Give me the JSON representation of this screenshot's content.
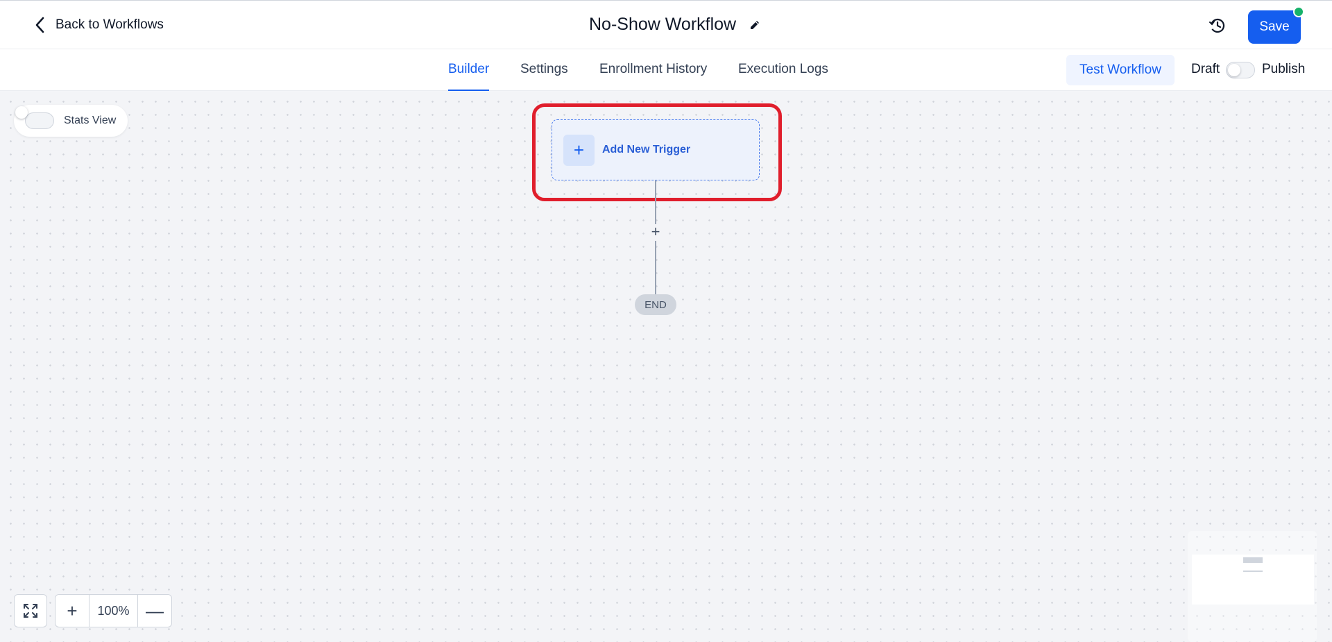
{
  "header": {
    "back_label": "Back to Workflows",
    "title": "No-Show Workflow",
    "save_label": "Save"
  },
  "tabs": [
    {
      "label": "Builder",
      "active": true
    },
    {
      "label": "Settings",
      "active": false
    },
    {
      "label": "Enrollment History",
      "active": false
    },
    {
      "label": "Execution Logs",
      "active": false
    }
  ],
  "actions": {
    "test_label": "Test Workflow",
    "draft_label": "Draft",
    "publish_label": "Publish",
    "published": false
  },
  "canvas": {
    "stats_label": "Stats View",
    "stats_enabled": false,
    "trigger_label": "Add New Trigger",
    "add_step_symbol": "+",
    "end_label": "END"
  },
  "zoom": {
    "plus": "+",
    "value": "100%",
    "minus": "—"
  },
  "colors": {
    "accent": "#155eef",
    "highlight": "#e01e2c",
    "status_dot": "#17b26a"
  },
  "icons": [
    "chevron-left-icon",
    "pencil-icon",
    "history-icon",
    "plus-icon",
    "fit-screen-icon"
  ]
}
